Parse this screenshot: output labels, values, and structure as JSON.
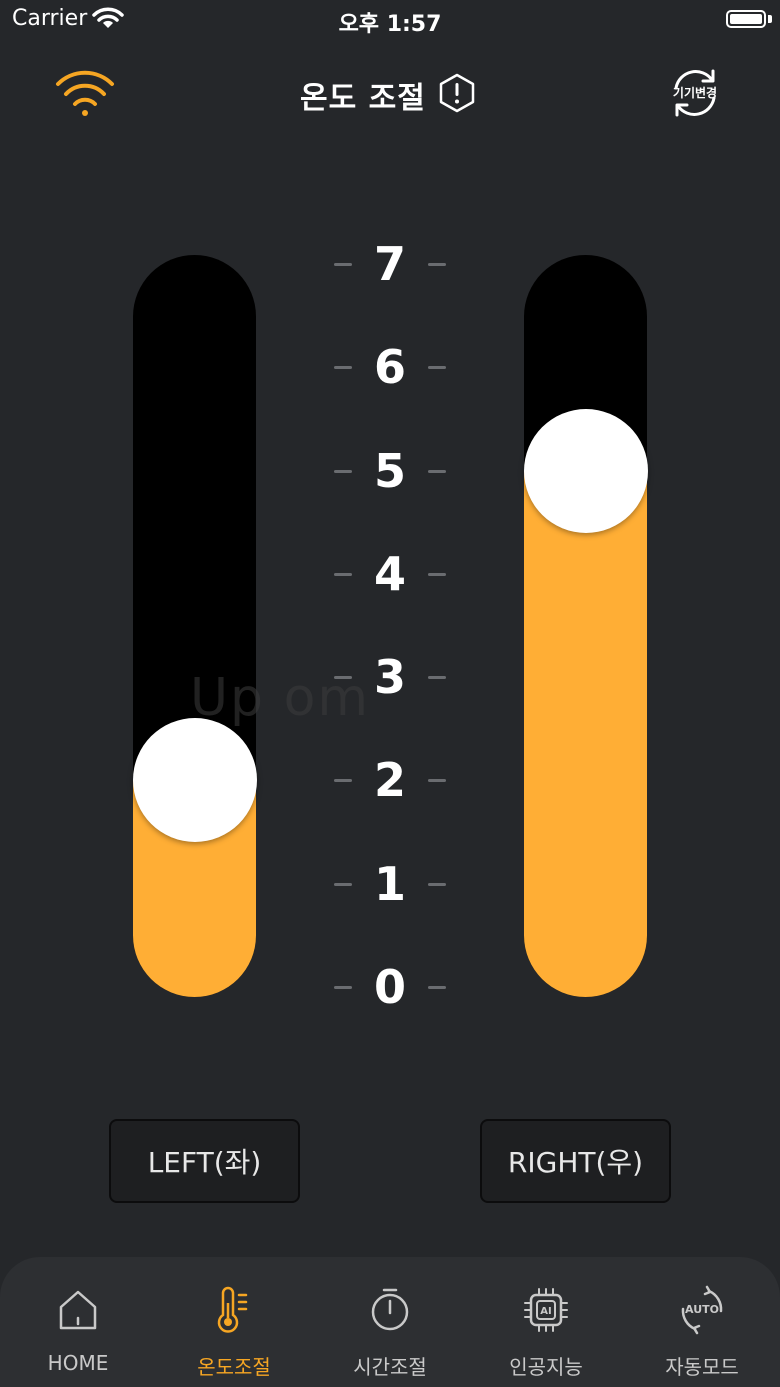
{
  "status_bar": {
    "carrier": "Carrier",
    "time": "오후 1:57"
  },
  "header": {
    "title": "온도 조절",
    "device_change_label": "기기변경"
  },
  "scale": {
    "labels": [
      "7",
      "6",
      "5",
      "4",
      "3",
      "2",
      "1",
      "0"
    ],
    "min": 0,
    "max": 7
  },
  "sliders": {
    "left": {
      "value": 2,
      "button_label": "LEFT(좌)"
    },
    "right": {
      "value": 5,
      "button_label": "RIGHT(우)"
    }
  },
  "watermark": "Up         om",
  "colors": {
    "accent": "#ffae35",
    "background": "#25272a",
    "track": "#000000"
  },
  "tabs": [
    {
      "label": "HOME",
      "icon": "home-icon",
      "active": false
    },
    {
      "label": "온도조절",
      "icon": "thermometer-icon",
      "active": true
    },
    {
      "label": "시간조절",
      "icon": "stopwatch-icon",
      "active": false
    },
    {
      "label": "인공지능",
      "icon": "ai-chip-icon",
      "active": false
    },
    {
      "label": "자동모드",
      "icon": "auto-mode-icon",
      "active": false
    }
  ]
}
